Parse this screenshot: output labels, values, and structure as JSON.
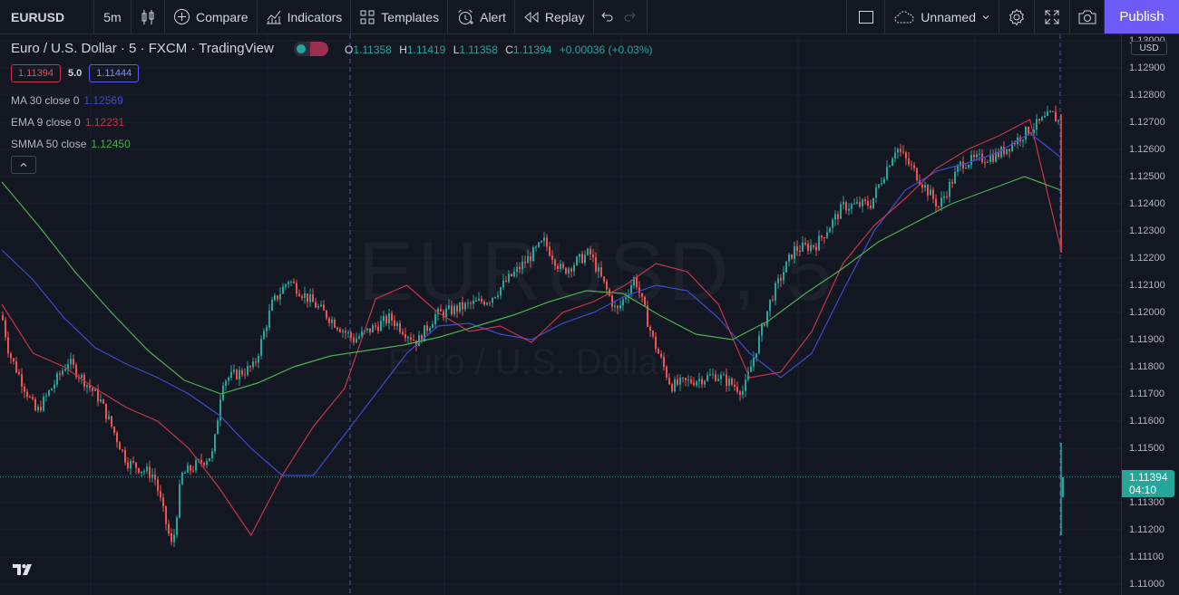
{
  "toolbar": {
    "symbol": "EURUSD",
    "interval": "5m",
    "compare": "Compare",
    "indicators": "Indicators",
    "templates": "Templates",
    "alert": "Alert",
    "replay": "Replay",
    "layout_name": "Unnamed",
    "publish": "Publish"
  },
  "legend": {
    "title": "Euro / U.S. Dollar · 5 · FXCM · TradingView",
    "ohlc": {
      "o_key": "O",
      "o": "1.11358",
      "h_key": "H",
      "h": "1.11419",
      "l_key": "L",
      "l": "1.11358",
      "c_key": "C",
      "c": "1.11394",
      "change": "+0.00036 (+0.03%)"
    },
    "bid": "1.11394",
    "spread": "5.0",
    "ask": "1.11444",
    "studies": [
      {
        "name": "MA 30 close 0",
        "value": "1.12569",
        "color": "#3f4bd1"
      },
      {
        "name": "EMA 9 close 0",
        "value": "1.12231",
        "color": "#c7344a"
      },
      {
        "name": "SMMA 50 close",
        "value": "1.12450",
        "color": "#4caf50"
      }
    ]
  },
  "watermark": {
    "symbol": "EURUSD, 5",
    "description": "Euro / U.S. Dollar"
  },
  "price_axis": {
    "currency": "USD",
    "ticks": [
      "1.13000",
      "1.12900",
      "1.12800",
      "1.12700",
      "1.12600",
      "1.12500",
      "1.12400",
      "1.12300",
      "1.12200",
      "1.12100",
      "1.12000",
      "1.11900",
      "1.11800",
      "1.11700",
      "1.11600",
      "1.11500",
      "1.11400",
      "1.11300",
      "1.11200",
      "1.11100",
      "1.11000"
    ],
    "last_price": "1.11394",
    "countdown": "04:10"
  },
  "colors": {
    "background": "#131722",
    "up": "#26a69a",
    "down": "#ef5350",
    "accent": "#6e5bf6",
    "ma": "#3f4bd1",
    "ema": "#c7344a",
    "smma": "#4caf50"
  },
  "chart_data": {
    "type": "candlestick",
    "symbol": "EURUSD",
    "timeframe": "5",
    "ylim": [
      1.11,
      1.1305
    ],
    "series": [
      {
        "name": "MA 30 close 0",
        "values": [
          1.1223,
          1.1212,
          1.1198,
          1.1187,
          1.1181,
          1.1176,
          1.117,
          1.1162,
          1.115,
          1.114,
          1.114,
          1.1155,
          1.117,
          1.1185,
          1.1195,
          1.1196,
          1.1192,
          1.119,
          1.1196,
          1.12,
          1.1206,
          1.121,
          1.1208,
          1.1198,
          1.1185,
          1.1176,
          1.1185,
          1.1208,
          1.123,
          1.1245,
          1.1252,
          1.1255,
          1.1259,
          1.1266,
          1.1257
        ]
      },
      {
        "name": "EMA 9 close 0",
        "values": [
          1.1203,
          1.1185,
          1.118,
          1.1172,
          1.1165,
          1.116,
          1.115,
          1.1135,
          1.1118,
          1.114,
          1.1158,
          1.1172,
          1.1205,
          1.121,
          1.12,
          1.1193,
          1.1195,
          1.1189,
          1.12,
          1.1204,
          1.121,
          1.1218,
          1.1215,
          1.1203,
          1.1176,
          1.1178,
          1.1193,
          1.1218,
          1.1232,
          1.1242,
          1.1253,
          1.126,
          1.1265,
          1.1271,
          1.1223
        ]
      },
      {
        "name": "SMMA 50 close",
        "values": [
          1.1248,
          1.1232,
          1.1215,
          1.12,
          1.1186,
          1.1175,
          1.117,
          1.1174,
          1.118,
          1.1184,
          1.1186,
          1.1188,
          1.1191,
          1.1195,
          1.1199,
          1.1204,
          1.1208,
          1.1207,
          1.1199,
          1.1192,
          1.119,
          1.1197,
          1.1207,
          1.1216,
          1.1226,
          1.1233,
          1.124,
          1.1245,
          1.125,
          1.1245
        ]
      }
    ],
    "last_price": 1.11394
  }
}
